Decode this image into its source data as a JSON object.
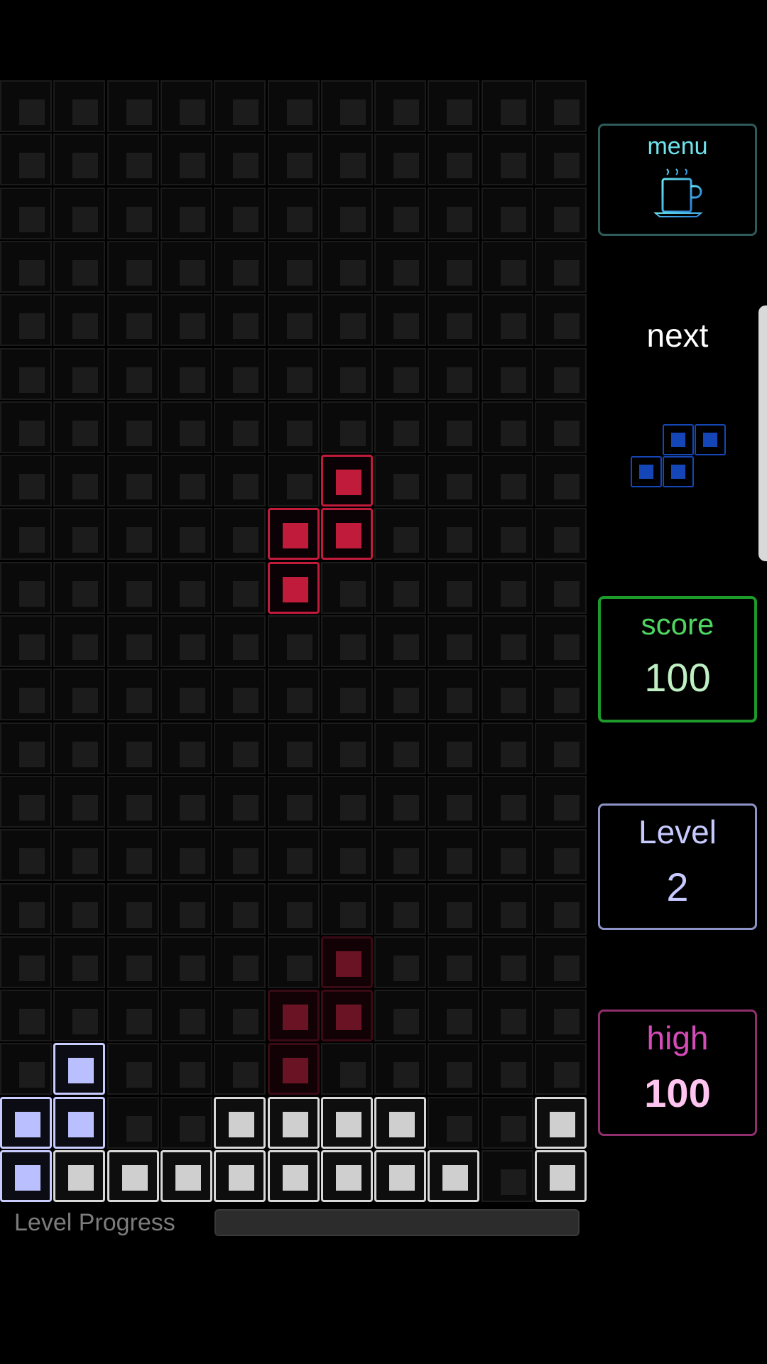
{
  "board": {
    "cols": 11,
    "rows": 21,
    "active_piece": [
      [
        6,
        7
      ],
      [
        5,
        8
      ],
      [
        6,
        8
      ],
      [
        5,
        9
      ]
    ],
    "ghost_piece": [
      [
        6,
        16
      ],
      [
        5,
        17
      ],
      [
        6,
        17
      ],
      [
        5,
        18
      ]
    ],
    "locked_cells": [
      {
        "col": 1,
        "row": 18,
        "color": "lavender"
      },
      {
        "col": 0,
        "row": 19,
        "color": "lavender"
      },
      {
        "col": 1,
        "row": 19,
        "color": "lavender"
      },
      {
        "col": 4,
        "row": 19,
        "color": "silver"
      },
      {
        "col": 5,
        "row": 19,
        "color": "silver"
      },
      {
        "col": 6,
        "row": 19,
        "color": "silver"
      },
      {
        "col": 7,
        "row": 19,
        "color": "silver"
      },
      {
        "col": 10,
        "row": 19,
        "color": "silver"
      },
      {
        "col": 0,
        "row": 20,
        "color": "lavender"
      },
      {
        "col": 1,
        "row": 20,
        "color": "silver"
      },
      {
        "col": 2,
        "row": 20,
        "color": "silver"
      },
      {
        "col": 3,
        "row": 20,
        "color": "silver"
      },
      {
        "col": 4,
        "row": 20,
        "color": "silver"
      },
      {
        "col": 5,
        "row": 20,
        "color": "silver"
      },
      {
        "col": 6,
        "row": 20,
        "color": "silver"
      },
      {
        "col": 7,
        "row": 20,
        "color": "silver"
      },
      {
        "col": 8,
        "row": 20,
        "color": "silver"
      },
      {
        "col": 10,
        "row": 20,
        "color": "silver"
      }
    ]
  },
  "sidebar": {
    "menu": {
      "label": "menu",
      "icon": "coffee-cup-icon"
    },
    "next": {
      "label": "next",
      "piece": [
        [
          1,
          0
        ],
        [
          2,
          0
        ],
        [
          0,
          1
        ],
        [
          1,
          1
        ]
      ]
    },
    "score": {
      "label": "score",
      "value": "100"
    },
    "level": {
      "label": "Level",
      "value": "2"
    },
    "high": {
      "label": "high",
      "value": "100"
    }
  },
  "progress": {
    "label": "Level Progress",
    "value": 0
  },
  "colors": {
    "active": "#c01b3a",
    "ghost": "#6a1324",
    "silver": "#cfcfcf",
    "lavender": "#b9bfff",
    "next": "#1546b8",
    "score": "#4fd561",
    "level": "#c7caff",
    "high": "#d64bb8"
  }
}
